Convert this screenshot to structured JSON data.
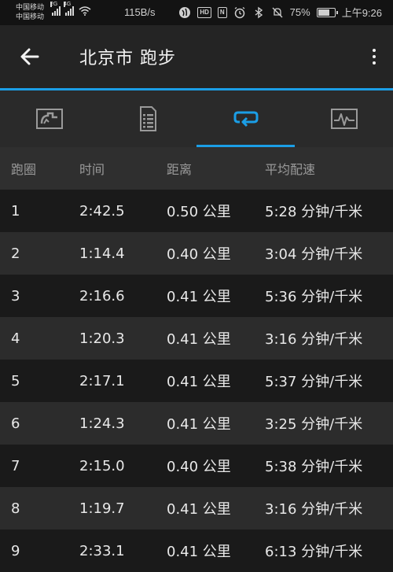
{
  "status_bar": {
    "carrier_top": "中国移动",
    "carrier_bottom": "中国移动",
    "net_type_1": "2G",
    "net_type_2": "4G",
    "speed": "115B/s",
    "battery_pct": "75%",
    "battery_level": 0.75,
    "time": "上午9:26",
    "hd": "HD",
    "nfc": "N"
  },
  "app_bar": {
    "title": "北京市 跑步"
  },
  "tabs": [
    {
      "icon": "map-route-icon",
      "active": false
    },
    {
      "icon": "document-list-icon",
      "active": false
    },
    {
      "icon": "laps-loop-icon",
      "active": true
    },
    {
      "icon": "chart-graph-icon",
      "active": false
    }
  ],
  "table": {
    "headers": [
      "跑圈",
      "时间",
      "距离",
      "平均配速"
    ],
    "rows": [
      [
        "1",
        "2:42.5",
        "0.50 公里",
        "5:28 分钟/千米"
      ],
      [
        "2",
        "1:14.4",
        "0.40 公里",
        "3:04 分钟/千米"
      ],
      [
        "3",
        "2:16.6",
        "0.41 公里",
        "5:36 分钟/千米"
      ],
      [
        "4",
        "1:20.3",
        "0.41 公里",
        "3:16 分钟/千米"
      ],
      [
        "5",
        "2:17.1",
        "0.41 公里",
        "5:37 分钟/千米"
      ],
      [
        "6",
        "1:24.3",
        "0.41 公里",
        "3:25 分钟/千米"
      ],
      [
        "7",
        "2:15.0",
        "0.40 公里",
        "5:38 分钟/千米"
      ],
      [
        "8",
        "1:19.7",
        "0.41 公里",
        "3:16 分钟/千米"
      ],
      [
        "9",
        "2:33.1",
        "0.41 公里",
        "6:13 分钟/千米"
      ]
    ]
  },
  "colors": {
    "accent": "#1b9ee6",
    "row_dark": "#1a1a1a",
    "row_light": "#2c2c2c"
  }
}
